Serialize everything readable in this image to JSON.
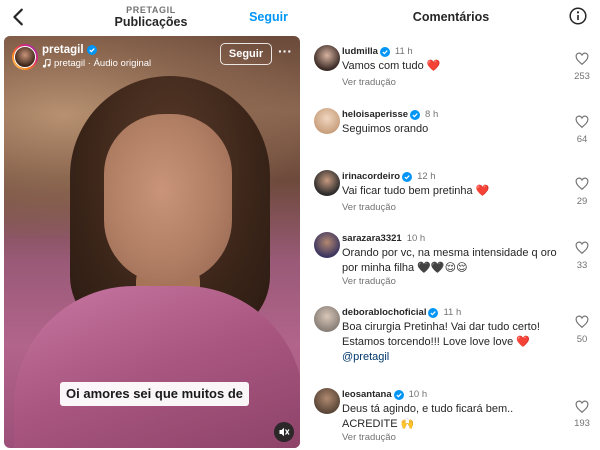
{
  "left": {
    "header": {
      "username": "PRETAGIL",
      "title": "Publicações",
      "follow_label": "Seguir"
    },
    "video": {
      "username": "pretagil",
      "audio_label": "pretagil · Áudio original",
      "follow_label": "Seguir",
      "more_label": "···",
      "caption": "Oi amores sei que muitos de"
    }
  },
  "right": {
    "title": "Comentários",
    "comments": [
      {
        "username": "ludmilla",
        "verified": true,
        "time": "11 h",
        "text": "Vamos com tudo ❤️",
        "translate": "Ver tradução",
        "likes": "253",
        "avatar_color": "#3a2a25"
      },
      {
        "username": "heloisaperisse",
        "verified": true,
        "time": "8 h",
        "text": "Seguimos orando",
        "translate": "",
        "likes": "64",
        "avatar_color": "#d9b59a"
      },
      {
        "username": "irinacordeiro",
        "verified": true,
        "time": "12 h",
        "text": "Vai ficar tudo bem pretinha ❤️",
        "translate": "Ver tradução",
        "likes": "29",
        "avatar_color": "#2b2b2b"
      },
      {
        "username": "sarazara3321",
        "verified": false,
        "time": "10 h",
        "text": "Orando por vc, na mesma intensidade q oro por minha filha 🖤🖤😌😌",
        "translate": "Ver tradução",
        "likes": "33",
        "avatar_color": "#3b3560"
      },
      {
        "username": "deborablochoficial",
        "verified": true,
        "time": "11 h",
        "text": "Boa cirurgia Pretinha! Vai dar tudo certo! Estamos torcendo!!! Love love love ❤️",
        "mention": "@pretagil",
        "translate": "",
        "likes": "50",
        "avatar_color": "#8a8078"
      },
      {
        "username": "leosantana",
        "verified": true,
        "time": "10 h",
        "text": "Deus tá agindo, e tudo ficará bem.. ACREDITE 🙌",
        "translate": "Ver tradução",
        "likes": "193",
        "avatar_color": "#5a4638"
      }
    ]
  },
  "colors": {
    "accent": "#0095f6",
    "verified": "#0095f6",
    "muted_text": "#737373",
    "heart": "#ed4956"
  },
  "icons": [
    "back-arrow-icon",
    "verified-badge-icon",
    "music-note-icon",
    "more-dots-icon",
    "mute-icon",
    "info-icon",
    "heart-outline-icon"
  ]
}
